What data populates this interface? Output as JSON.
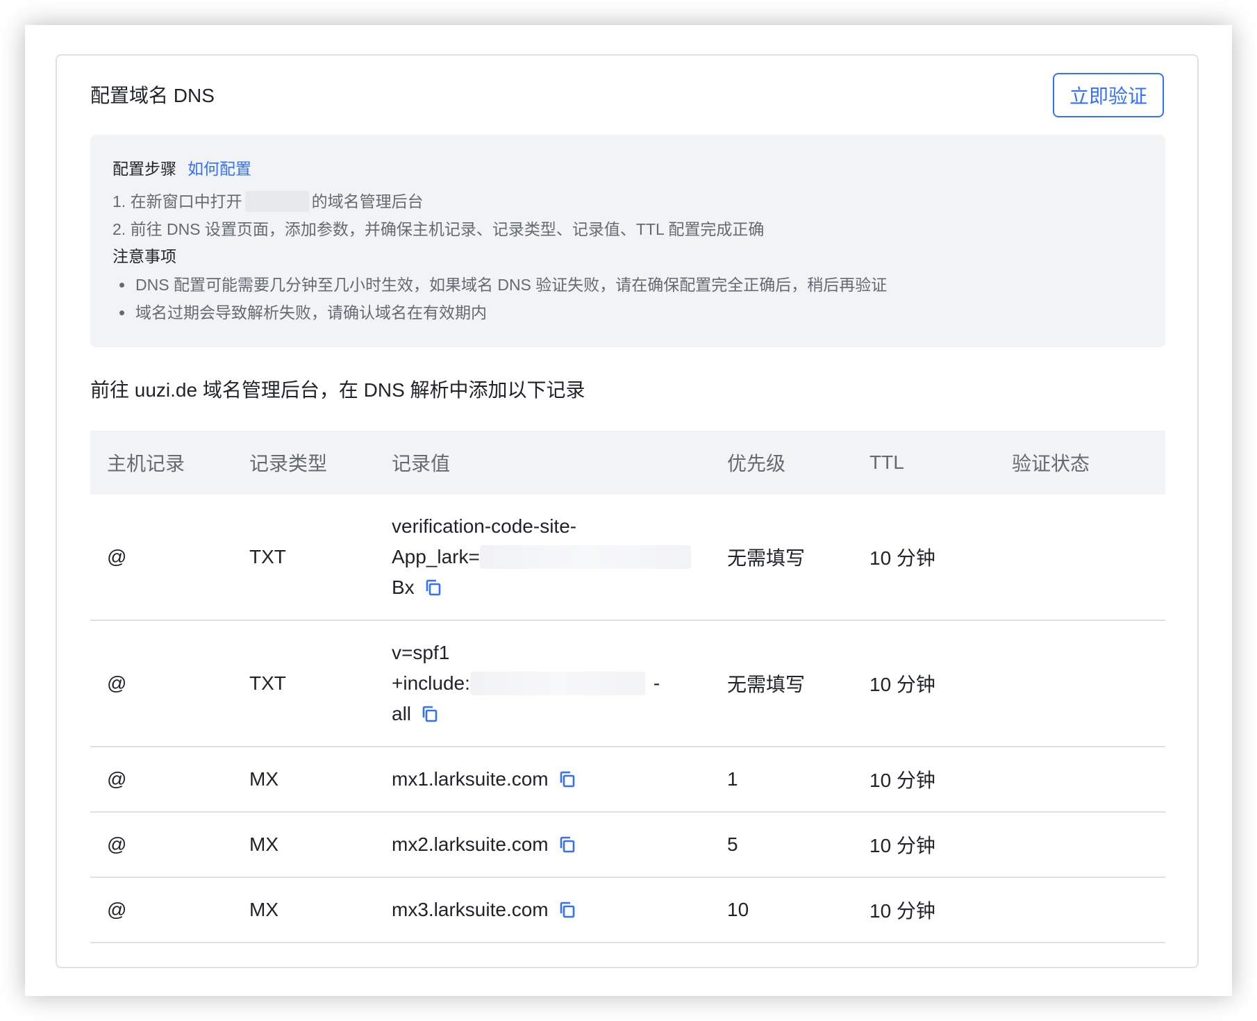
{
  "header": {
    "title": "配置域名 DNS",
    "verify_button": "立即验证"
  },
  "guide": {
    "steps_heading": "配置步骤",
    "how_to_link": "如何配置",
    "step1_prefix": "1. 在新窗口中打开",
    "step1_suffix": "的域名管理后台",
    "step2": "2. 前往 DNS 设置页面，添加参数，并确保主机记录、记录类型、记录值、TTL 配置完成正确",
    "notes_heading": "注意事项",
    "notes": [
      "DNS 配置可能需要几分钟至几小时生效，如果域名 DNS 验证失败，请在确保配置完全正确后，稍后再验证",
      "域名过期会导致解析失败，请确认域名在有效期内"
    ]
  },
  "instruction": "前往 uuzi.de 域名管理后台，在 DNS 解析中添加以下记录",
  "table": {
    "columns": [
      "主机记录",
      "记录类型",
      "记录值",
      "优先级",
      "TTL",
      "验证状态"
    ],
    "rows": [
      {
        "host": "@",
        "type": "TXT",
        "value_lines": [
          "verification-code-site-",
          "App_lark=",
          "Bx"
        ],
        "priority": "无需填写",
        "ttl": "10 分钟",
        "status": ""
      },
      {
        "host": "@",
        "type": "TXT",
        "value_lines": [
          "v=spf1",
          "+include:",
          "-",
          "all"
        ],
        "priority": "无需填写",
        "ttl": "10 分钟",
        "status": ""
      },
      {
        "host": "@",
        "type": "MX",
        "value": "mx1.larksuite.com",
        "priority": "1",
        "ttl": "10 分钟",
        "status": ""
      },
      {
        "host": "@",
        "type": "MX",
        "value": "mx2.larksuite.com",
        "priority": "5",
        "ttl": "10 分钟",
        "status": ""
      },
      {
        "host": "@",
        "type": "MX",
        "value": "mx3.larksuite.com",
        "priority": "10",
        "ttl": "10 分钟",
        "status": ""
      }
    ]
  },
  "colors": {
    "accent": "#3370ff",
    "text_primary": "#1f2329",
    "text_secondary": "#646a73",
    "panel_bg": "#f2f3f5",
    "border": "#dee0e3"
  },
  "icons": {
    "copy": "copy-icon"
  }
}
